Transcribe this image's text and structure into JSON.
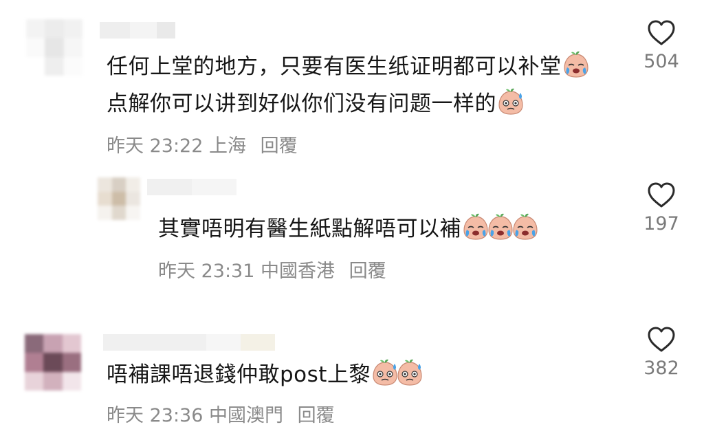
{
  "comments": [
    {
      "text_line1": "任何上堂的地方，只要有医生纸证明都可以补堂",
      "text_line2": "点解你可以讲到好似你们没有问题一样的",
      "time": "昨天 23:22",
      "location": "上海",
      "reply": "回覆",
      "likes": "504",
      "emoji_line1": [
        "crying-emoji"
      ],
      "emoji_line2": [
        "sweat-emoji"
      ]
    },
    {
      "text": "其實唔明有醫生紙點解唔可以補",
      "time": "昨天 23:31",
      "location": "中國香港",
      "reply": "回覆",
      "likes": "197",
      "emoji": [
        "crying-emoji",
        "crying-emoji",
        "crying-emoji"
      ]
    },
    {
      "text": "唔補課唔退錢仲敢post上黎",
      "time": "昨天 23:36",
      "location": "中國澳門",
      "reply": "回覆",
      "likes": "382",
      "emoji": [
        "sweat-emoji",
        "sweat-emoji"
      ]
    }
  ],
  "colors": {
    "text": "#161616",
    "meta": "#8a8a8a",
    "emoji_face": "#f3b8a4",
    "emoji_leaf": "#5aa85a",
    "tear": "#4aa3e8"
  }
}
